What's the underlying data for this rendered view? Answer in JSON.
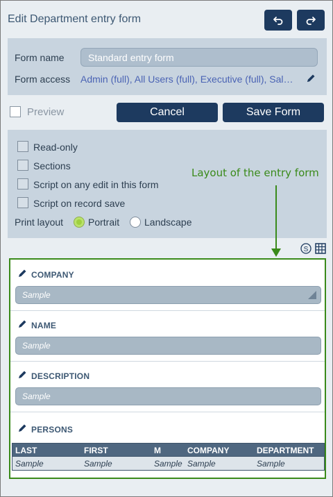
{
  "header": {
    "title": "Edit Department entry form",
    "undo_icon": "undo-icon",
    "redo_icon": "redo-icon"
  },
  "form_settings": {
    "form_name_label": "Form name",
    "form_name_value": "Standard entry form",
    "form_access_label": "Form access",
    "form_access_value": "Admin (full), All Users (full), Executive (full), Sal…"
  },
  "actions": {
    "preview_label": "Preview",
    "cancel_label": "Cancel",
    "save_label": "Save Form"
  },
  "options": {
    "checkboxes": [
      {
        "label": "Read-only",
        "checked": false
      },
      {
        "label": "Sections",
        "checked": false
      },
      {
        "label": "Script on any edit in this form",
        "checked": false
      },
      {
        "label": "Script on record save",
        "checked": false
      }
    ],
    "print_layout_label": "Print layout",
    "portrait_label": "Portrait",
    "landscape_label": "Landscape",
    "selected_print_layout": "Portrait"
  },
  "annotation": "Layout of the entry form",
  "layout": {
    "fields": [
      {
        "title": "COMPANY",
        "placeholder": "Sample",
        "type": "dropdown"
      },
      {
        "title": "NAME",
        "placeholder": "Sample",
        "type": "text"
      },
      {
        "title": "DESCRIPTION",
        "placeholder": "Sample",
        "type": "text"
      }
    ],
    "persons": {
      "title": "PERSONS",
      "columns": [
        "LAST",
        "FIRST",
        "M",
        "COMPANY",
        "DEPARTMENT"
      ],
      "row": [
        "Sample",
        "Sample",
        "Sample",
        "Sample",
        "Sample"
      ]
    }
  },
  "colors": {
    "primary_button": "#1d3a5f",
    "panel": "#c8d4df",
    "annotation": "#3a8a1a",
    "link": "#4a63b4"
  }
}
